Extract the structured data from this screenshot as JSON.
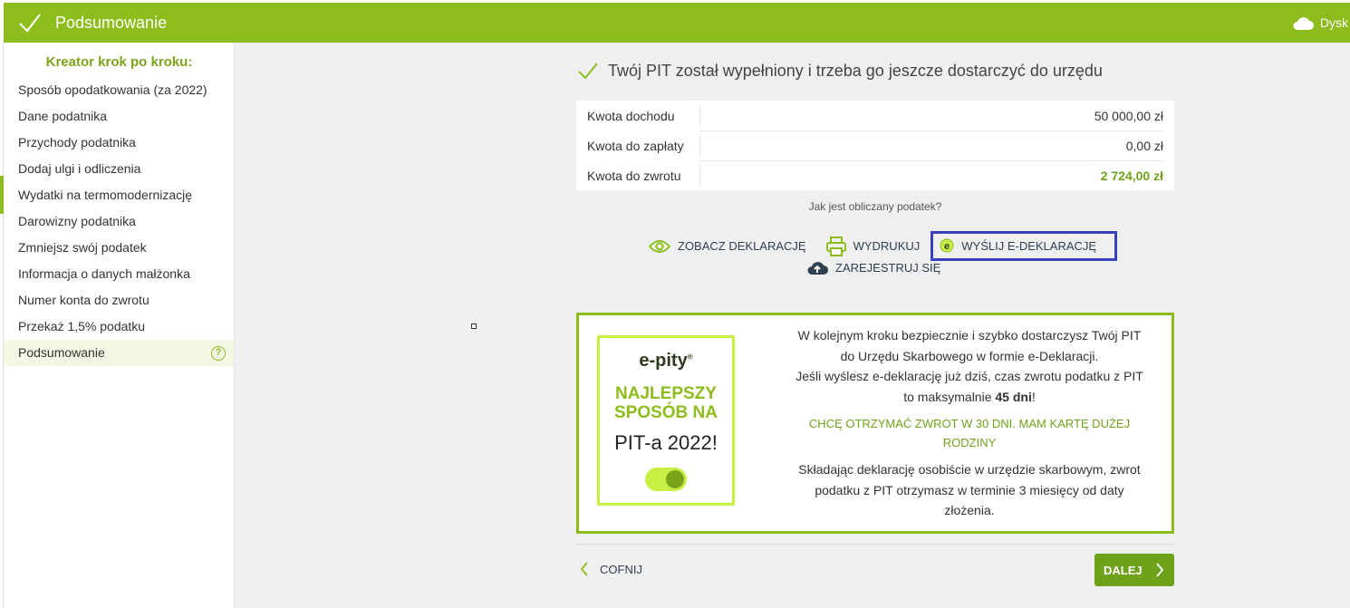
{
  "header": {
    "title": "Podsumowanie",
    "cloud_label": "Dysk"
  },
  "sidebar": {
    "title": "Kreator krok po kroku:",
    "items": [
      {
        "label": "Sposób opodatkowania (za 2022)"
      },
      {
        "label": "Dane podatnika"
      },
      {
        "label": "Przychody podatnika"
      },
      {
        "label": "Dodaj ulgi i odliczenia"
      },
      {
        "label": "Wydatki na termomodernizację"
      },
      {
        "label": "Darowizny podatnika"
      },
      {
        "label": "Zmniejsz swój podatek"
      },
      {
        "label": "Informacja o danych małżonka"
      },
      {
        "label": "Numer konta do zwrotu"
      },
      {
        "label": "Przekaż 1,5% podatku"
      },
      {
        "label": "Podsumowanie",
        "help": "?"
      }
    ]
  },
  "main": {
    "heading": "Twój PIT został wypełniony i trzeba go jeszcze dostarczyć do urzędu",
    "summary": [
      {
        "label": "Kwota dochodu",
        "value": "50 000,00 zł"
      },
      {
        "label": "Kwota do zapłaty",
        "value": "0,00 zł"
      },
      {
        "label": "Kwota do zwrotu",
        "value": "2 724,00 zł"
      }
    ],
    "how_calc_link": "Jak jest obliczany podatek?",
    "actions": {
      "view": "ZOBACZ DEKLARACJĘ",
      "print": "WYDRUKUJ",
      "send": "WYŚLIJ E-DEKLARACJĘ",
      "register": "ZAREJESTRUJ SIĘ"
    },
    "promo": {
      "badge_logo": "e-pity",
      "badge_logo_mark": "®",
      "badge_best_line1": "NAJLEPSZY",
      "badge_best_line2": "SPOSÓB NA",
      "badge_pit": "PIT-a 2022!",
      "para1_part1": "W kolejnym kroku bezpiecznie i szybko dostarczysz Twój PIT do Urzędu Skarbowego w formie e-Deklaracji.",
      "para1_part2": "Jeśli wyślesz e-deklarację już dziś, czas zwrotu podatku z PIT to maksymalnie",
      "para1_bold": "45 dni",
      "para1_end": "!",
      "link": "CHCĘ OTRZYMAĆ ZWROT W 30 DNI. MAM KARTĘ DUŻEJ RODZINY",
      "para2": "Składając deklarację osobiście w urzędzie skarbowym, zwrot podatku z PIT otrzymasz w terminie 3 miesięcy od daty złożenia."
    },
    "nav": {
      "back": "COFNIJ",
      "next": "DALEJ"
    }
  },
  "colors": {
    "brand_green": "#8dbd1d",
    "highlight_blue": "#3a41bd",
    "accent_lime": "#c7ef44"
  }
}
